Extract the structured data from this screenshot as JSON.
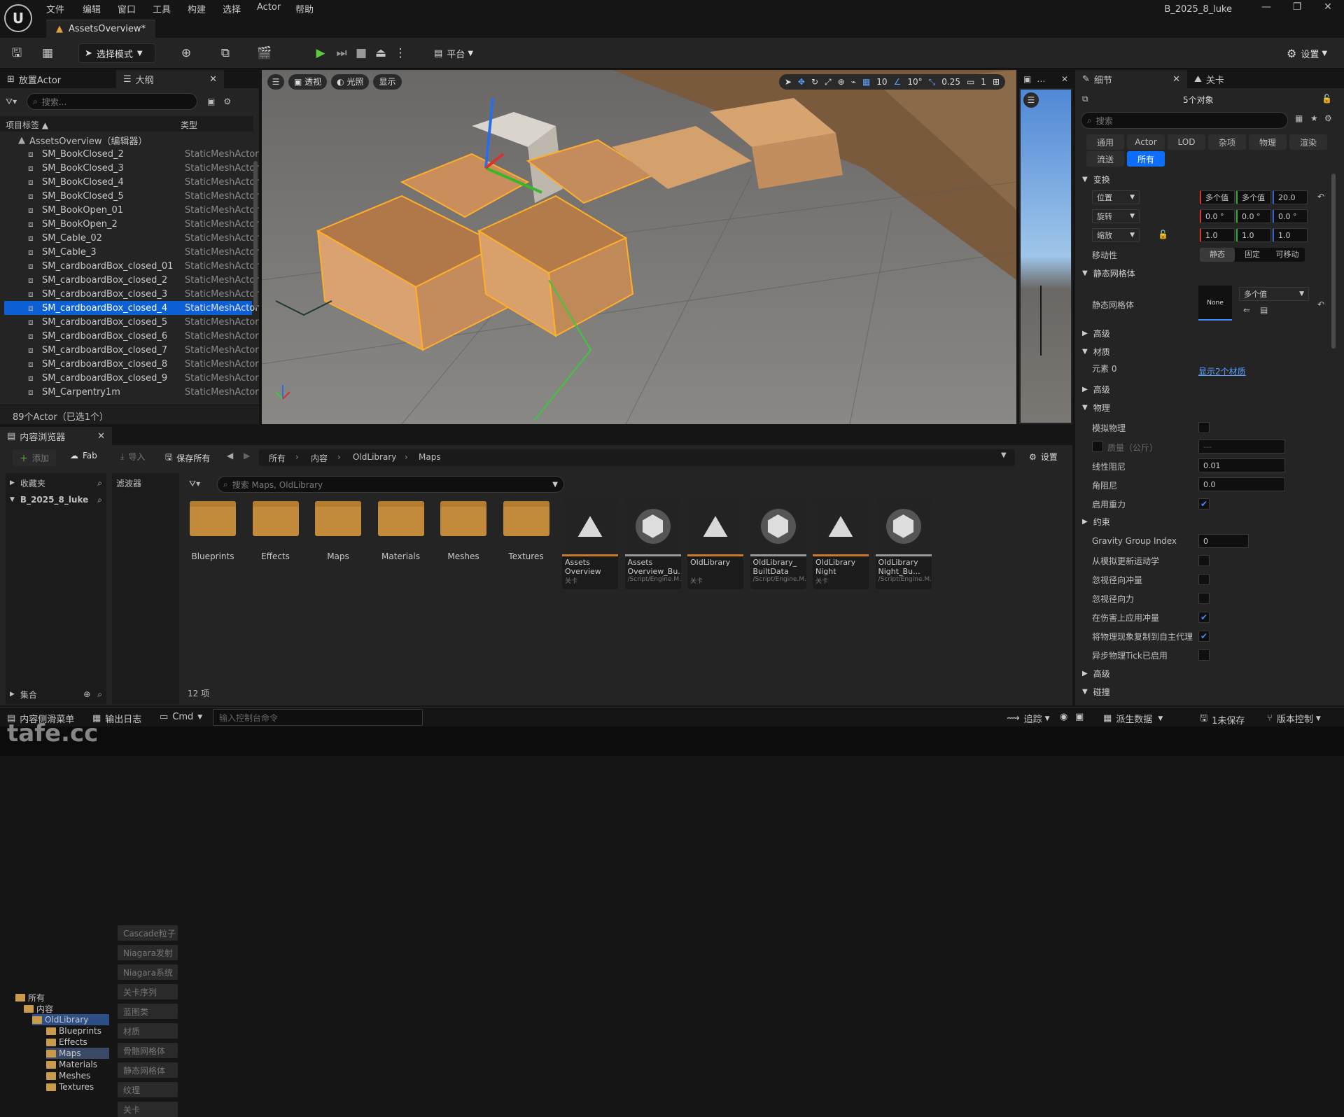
{
  "menu": {
    "items": [
      "文件",
      "编辑",
      "窗口",
      "工具",
      "构建",
      "选择",
      "Actor",
      "帮助"
    ]
  },
  "window": {
    "title": "B_2025_8_luke",
    "doc_tab": "AssetsOverview*",
    "logo": "U"
  },
  "toolbar": {
    "mode": "选择模式",
    "platform": "平台",
    "settings": "设置"
  },
  "outliner": {
    "tab_place": "放置Actor",
    "tab_outline": "大纲",
    "search_placeholder": "搜索...",
    "col_label": "项目标签 ▲",
    "col_type": "类型",
    "root": "AssetsOverview（编辑器）",
    "rows": [
      {
        "name": "SM_BookClosed_2",
        "type": "StaticMeshActor"
      },
      {
        "name": "SM_BookClosed_3",
        "type": "StaticMeshActor"
      },
      {
        "name": "SM_BookClosed_4",
        "type": "StaticMeshActor"
      },
      {
        "name": "SM_BookClosed_5",
        "type": "StaticMeshActor"
      },
      {
        "name": "SM_BookOpen_01",
        "type": "StaticMeshActor"
      },
      {
        "name": "SM_BookOpen_2",
        "type": "StaticMeshActor"
      },
      {
        "name": "SM_Cable_02",
        "type": "StaticMeshActor"
      },
      {
        "name": "SM_Cable_3",
        "type": "StaticMeshActor"
      },
      {
        "name": "SM_cardboardBox_closed_01",
        "type": "StaticMeshActor"
      },
      {
        "name": "SM_cardboardBox_closed_2",
        "type": "StaticMeshActor"
      },
      {
        "name": "SM_cardboardBox_closed_3",
        "type": "StaticMeshActor"
      },
      {
        "name": "SM_cardboardBox_closed_4",
        "type": "StaticMeshActor"
      },
      {
        "name": "SM_cardboardBox_closed_5",
        "type": "StaticMeshActor"
      },
      {
        "name": "SM_cardboardBox_closed_6",
        "type": "StaticMeshActor"
      },
      {
        "name": "SM_cardboardBox_closed_7",
        "type": "StaticMeshActor"
      },
      {
        "name": "SM_cardboardBox_closed_8",
        "type": "StaticMeshActor"
      },
      {
        "name": "SM_cardboardBox_closed_9",
        "type": "StaticMeshActor"
      },
      {
        "name": "SM_Carpentry1m",
        "type": "StaticMeshActor"
      }
    ],
    "selected_index": 11,
    "footer": "89个Actor（已选1个）"
  },
  "viewport": {
    "btn_perspective": "透视",
    "btn_lit": "光照",
    "btn_show": "显示",
    "grid": "10",
    "rot": "10°",
    "scale": "0.25",
    "cam": "1"
  },
  "details": {
    "tab_details": "细节",
    "tab_level": "关卡",
    "count": "5个对象",
    "search_placeholder": "搜索",
    "filters": [
      "通用",
      "Actor",
      "LOD",
      "杂项",
      "物理",
      "渲染",
      "流送",
      "所有"
    ],
    "sec_transform": "变换",
    "loc_label": "位置",
    "rot_label": "旋转",
    "scale_label": "缩放",
    "loc_vals": [
      "多个值",
      "多个值",
      "20.0"
    ],
    "rot_vals": [
      "0.0 °",
      "0.0 °",
      "0.0 °"
    ],
    "scale_vals": [
      "1.0",
      "1.0",
      "1.0"
    ],
    "mobility_label": "移动性",
    "mobility": [
      "静态",
      "固定",
      "可移动"
    ],
    "sec_mesh": "静态网格体",
    "mesh_label": "静态网格体",
    "mesh_none": "None",
    "mesh_multi": "多个值",
    "adv": "高级",
    "sec_mat": "材质",
    "elem0": "元素 0",
    "show_mats": "显示2个材质",
    "sec_physics": "物理",
    "sim_physics": "模拟物理",
    "mass": "质量（公斤）",
    "mass_val": "---",
    "lin_damp": "线性阻尼",
    "lin_damp_val": "0.01",
    "ang_damp": "角阻尼",
    "ang_damp_val": "0.0",
    "gravity": "启用重力",
    "constraints": "约束",
    "gravity_group": "Gravity Group Index",
    "gravity_group_val": "0",
    "kin_update": "从模拟更新运动学",
    "ignore_radial_impulse": "忽视径向冲量",
    "ignore_radial_force": "忽视径向力",
    "apply_impulse": "在伤害上应用冲量",
    "replicate": "将物理现象复制到自主代理",
    "async_tick": "异步物理Tick已启用",
    "collision": "碰撞"
  },
  "content": {
    "tab": "内容浏览器",
    "add": "添加",
    "fab": "Fab",
    "import": "导入",
    "save_all": "保存所有",
    "settings": "设置",
    "crumbs": [
      "所有",
      "内容",
      "OldLibrary",
      "Maps"
    ],
    "favorites": "收藏夹",
    "project": "B_2025_8_luke",
    "filters_title": "滤波器",
    "search_placeholder": "搜索 Maps, OldLibrary",
    "tree": [
      "所有",
      "内容",
      "OldLibrary",
      "Blueprints",
      "Effects",
      "Maps",
      "Materials",
      "Meshes",
      "Textures"
    ],
    "filters": [
      "Cascade粒子",
      "Niagara发射",
      "Niagara系统",
      "关卡序列",
      "蓝图类",
      "材质",
      "骨骼网格体",
      "静态网格体",
      "纹理",
      "关卡"
    ],
    "folders": [
      "Blueprints",
      "Effects",
      "Maps",
      "Materials",
      "Meshes",
      "Textures"
    ],
    "assets": [
      {
        "name": "Assets Overview",
        "type": "关卡",
        "kind": "map"
      },
      {
        "name": "Assets Overview_Bu...",
        "type": "/Script/Engine.M...",
        "kind": "data"
      },
      {
        "name": "OldLibrary",
        "type": "关卡",
        "kind": "map"
      },
      {
        "name": "OldLibrary_ BuiltData",
        "type": "/Script/Engine.M...",
        "kind": "data"
      },
      {
        "name": "OldLibrary Night",
        "type": "关卡",
        "kind": "map"
      },
      {
        "name": "OldLibrary Night_Bu...",
        "type": "/Script/Engine.M...",
        "kind": "data"
      }
    ],
    "count": "12 项",
    "collections": "集合"
  },
  "status": {
    "drawer": "内容侧滑菜单",
    "log": "输出日志",
    "cmd": "Cmd",
    "cmd_placeholder": "输入控制台命令",
    "trace": "追踪",
    "derived": "派生数据",
    "unsaved": "1未保存",
    "source": "版本控制"
  },
  "watermark": "tafe.cc"
}
